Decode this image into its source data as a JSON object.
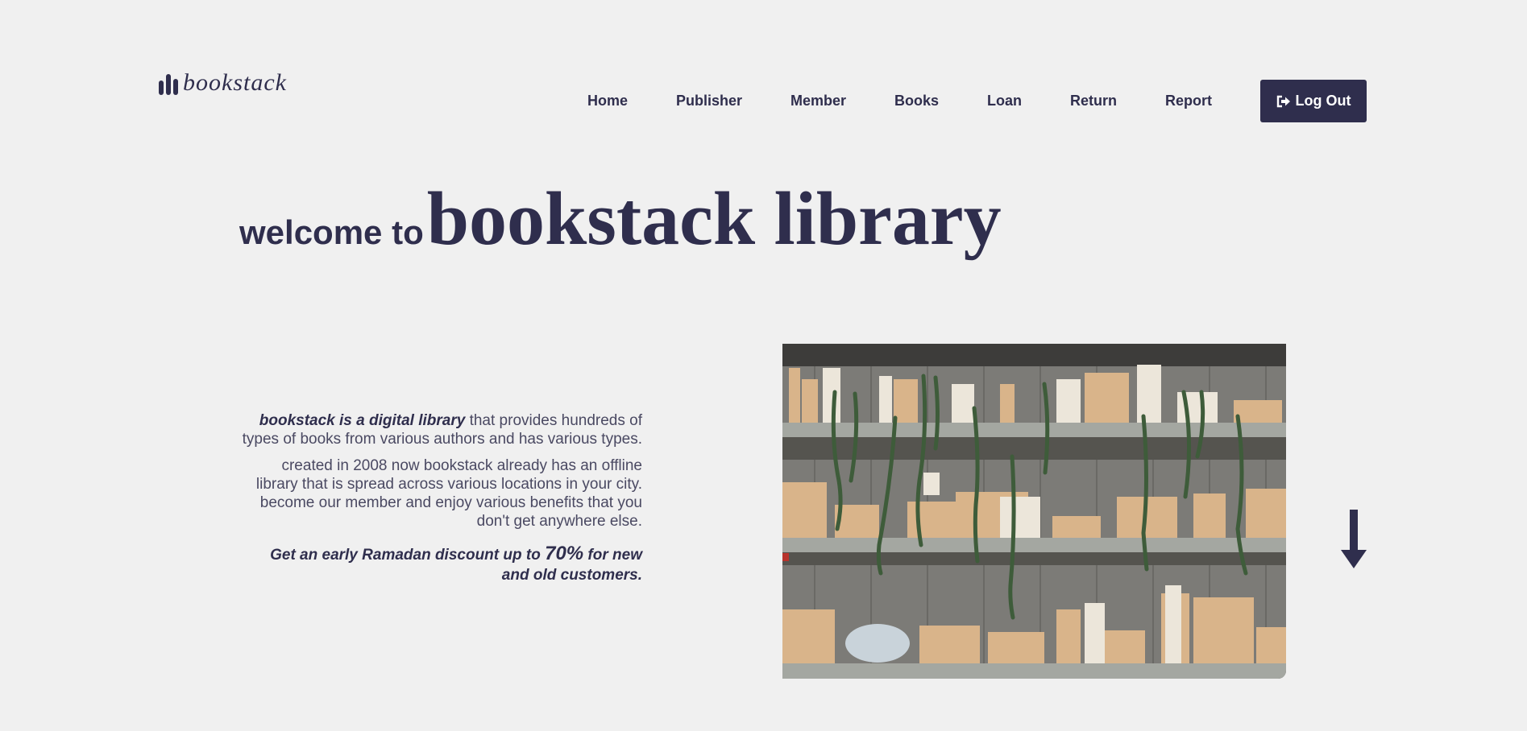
{
  "brand": {
    "name": "bookstack",
    "icon": "bar-chart-logo-icon"
  },
  "nav": {
    "items": [
      {
        "label": "Home"
      },
      {
        "label": "Publisher"
      },
      {
        "label": "Member"
      },
      {
        "label": "Books"
      },
      {
        "label": "Loan"
      },
      {
        "label": "Return"
      },
      {
        "label": "Report"
      }
    ],
    "logout_label": "Log Out",
    "logout_icon": "sign-out-icon"
  },
  "hero": {
    "prefix": "welcome to",
    "title": "bookstack library"
  },
  "about": {
    "p1_strong": "bookstack is a digital library",
    "p1_rest": " that provides hundreds of types of books from various authors and has various types.",
    "p2": "created in 2008 now bookstack already has an offline library that is spread across various locations in your city. become our member and enjoy various benefits that you don't get anywhere else.",
    "promo_before": "Get an early Ramadan discount up to ",
    "promo_value": "70%",
    "promo_after": " for new and old customers."
  },
  "image": {
    "subject": "bookshelf-with-plants-photo"
  },
  "scroll_icon": "arrow-down-icon",
  "colors": {
    "primary": "#2f2e4d",
    "background": "#f0f0f0",
    "text": "#4a4962"
  }
}
